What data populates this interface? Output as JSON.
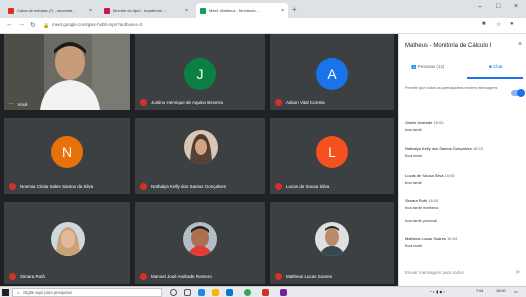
{
  "browser": {
    "tabs": [
      {
        "label": "Caixa de entrada (7) - seuemai...",
        "favicon_color": "#d93025"
      },
      {
        "label": "Moodle do Ajuri - Academia ...",
        "favicon_color": "#c2185b"
      },
      {
        "label": "Meet: Matheus - Monitoria ...",
        "favicon_color": "#0f9d58"
      }
    ],
    "new_tab": "+",
    "url": "meet.google.com/gwx-hxbb-mpn?authuser=0",
    "minimize": "–",
    "maximize": "□",
    "close": "×"
  },
  "meeting": {
    "self_label": "Você",
    "participants": [
      {
        "name": "Justino Henrique de Aquino Bezerra",
        "initial": "J",
        "color": "#0b8043"
      },
      {
        "name": "Adson Vital Correia",
        "initial": "A",
        "color": "#1a73e8"
      },
      {
        "name": "Noemia Cintia Sales Santos da Silva",
        "initial": "N",
        "color": "#e8710a"
      },
      {
        "name": "Nathalya Kelly dos Santos Gonçalves",
        "initial": "",
        "color": "#6d5346"
      },
      {
        "name": "Lucas de Sousa Silva",
        "initial": "L",
        "color": "#f4511e"
      },
      {
        "name": "Simara Ruth",
        "initial": "",
        "color": "#a1887f"
      },
      {
        "name": "Manoel José Andrade Romero",
        "initial": "",
        "color": "#8d6e63"
      },
      {
        "name": "Matheus Lucas Soares",
        "initial": "",
        "color": "#9e9e9e"
      }
    ]
  },
  "side_panel": {
    "title": "Matheus - Monitoria de Cálculo I",
    "close": "×",
    "people_tab": "Pessoas (12)",
    "chat_tab": "Chat",
    "toggle_text": "Permitir que todos os participantes enviem mensagens",
    "messages": [
      {
        "name": "Gisele Andrade",
        "time": "16:53",
        "text": "boa tarde"
      },
      {
        "name": "Nathalya Kelly dos Santos Gonçalves",
        "time": "16:53",
        "text": "Boa tarde"
      },
      {
        "name": "Lucas de Sousa Silva",
        "time": "16:54",
        "text": "boa tarde"
      },
      {
        "name": "Simara Ruth",
        "time": "16:54",
        "text": "boa tarde matheus"
      },
      {
        "name": "",
        "time": "",
        "text": "boa tarde pessoal"
      },
      {
        "name": "Matheus Lucas Soares",
        "time": "16:54",
        "text": "Boa tarde"
      }
    ],
    "input_placeholder": "Enviar mensagem para todos",
    "send_icon": "➤"
  },
  "taskbar": {
    "search_placeholder": "Digite aqui para pesquisar",
    "time": "7:04",
    "date": "19:00"
  }
}
